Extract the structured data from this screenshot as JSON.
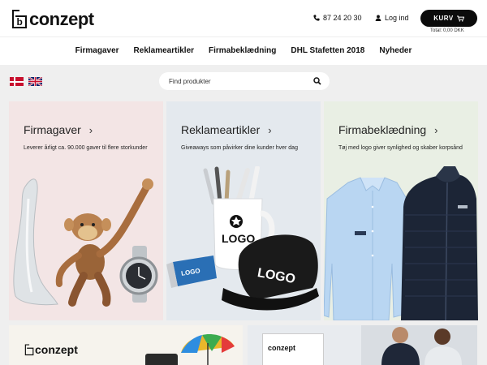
{
  "brand": {
    "name": "conzept",
    "mark": "b"
  },
  "header": {
    "phone": "87 24 20 30",
    "login": "Log ind",
    "cart_label": "KURV",
    "cart_total": "Total: 0,00 DKK"
  },
  "nav": {
    "items": [
      "Firmagaver",
      "Reklameartikler",
      "Firmabeklædning",
      "DHL Stafetten 2018",
      "Nyheder"
    ]
  },
  "search": {
    "placeholder": "Find produkter"
  },
  "panels": [
    {
      "title": "Firmagaver",
      "desc": "Leverer årligt ca. 90.000 gaver til flere storkunder"
    },
    {
      "title": "Reklameartikler",
      "desc": "Giveaways som påvirker dine kunder hver dag"
    },
    {
      "title": "Firmabeklædning",
      "desc": "Tøj med logo giver synlighed og skaber korpsånd"
    }
  ],
  "art": {
    "logo_text": "LOGO"
  },
  "colors": {
    "accent": "#0b0b0b",
    "panel1": "#f3e5e5",
    "panel2": "#e4e9ee",
    "panel3": "#e9efe4"
  },
  "icons": {
    "phone": "phone-icon",
    "user": "user-icon",
    "cart": "cart-icon",
    "search": "search-icon",
    "chevron": "chevron-right-icon"
  }
}
